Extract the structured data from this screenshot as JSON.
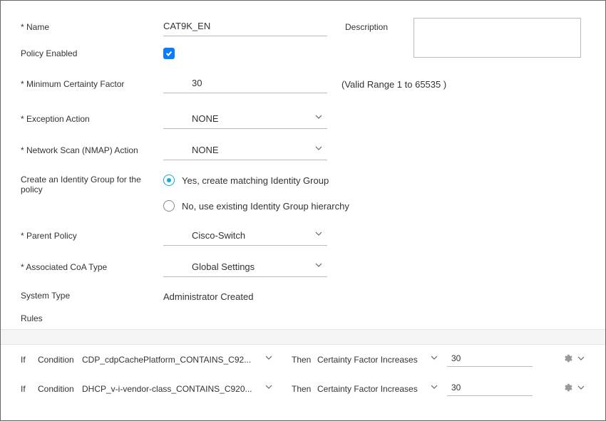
{
  "labels": {
    "name": "* Name",
    "description": "Description",
    "policy_enabled": "Policy Enabled",
    "mcf": "* Minimum Certainty Factor",
    "valid_range": "(Valid Range 1 to 65535 )",
    "exception_action": "* Exception Action",
    "nmap_action": "* Network Scan (NMAP) Action",
    "create_group": "Create an Identity Group for the policy",
    "radio_yes": "Yes, create matching Identity Group",
    "radio_no": "No, use existing Identity Group hierarchy",
    "parent_policy": "* Parent Policy",
    "coa_type": "* Associated CoA Type",
    "system_type": "System Type",
    "rules": "Rules",
    "if": "If",
    "condition": "Condition",
    "then": "Then"
  },
  "values": {
    "name": "CAT9K_EN",
    "description": "",
    "mcf": "30",
    "exception_action": "NONE",
    "nmap_action": "NONE",
    "parent_policy": "Cisco-Switch",
    "coa_type": "Global Settings",
    "system_type": "Administrator Created"
  },
  "rules_data": [
    {
      "condition": "CDP_cdpCachePlatform_CONTAINS_C92...",
      "factor": "Certainty Factor Increases",
      "value": "30"
    },
    {
      "condition": "DHCP_v-i-vendor-class_CONTAINS_C920...",
      "factor": "Certainty Factor Increases",
      "value": "30"
    }
  ]
}
